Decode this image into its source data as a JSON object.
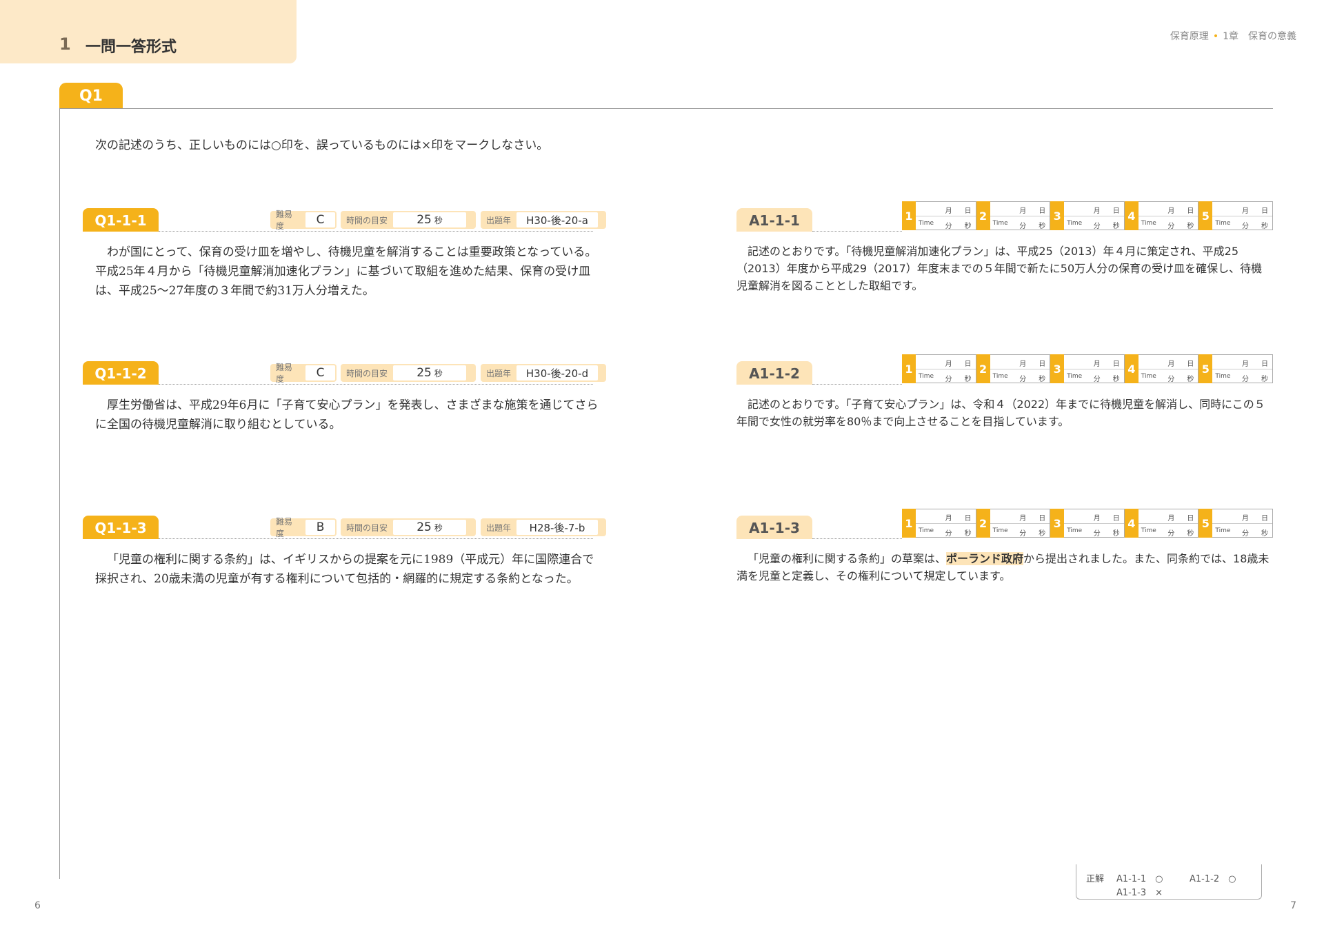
{
  "chapter": {
    "number": "1",
    "title": "一問一答形式"
  },
  "running_head": {
    "subject": "保育原理",
    "chapter": "1章　保育の意義"
  },
  "section": {
    "tag": "Q1",
    "instruction": "次の記述のうち、正しいものには○印を、誤っているものには×印をマークしなさい。"
  },
  "labels": {
    "difficulty": "難易度",
    "time": "時間の目安",
    "year": "出題年",
    "seconds_unit": "秒"
  },
  "tracker_labels": {
    "month": "月",
    "day": "日",
    "time": "Time",
    "min": "分",
    "sec": "秒"
  },
  "questions": [
    {
      "id": "Q1-1-1",
      "difficulty": "C",
      "time": "25",
      "year": "H30-後-20-a",
      "text": "わが国にとって、保育の受け皿を増やし、待機児童を解消することは重要政策となっている。平成25年４月から「待機児童解消加速化プラン」に基づいて取組を進めた結果、保育の受け皿は、平成25～27年度の３年間で約31万人分増えた。",
      "answer_id": "A1-1-1",
      "answer": "記述のとおりです。「待機児童解消加速化プラン」は、平成25（2013）年４月に策定され、平成25（2013）年度から平成29（2017）年度末までの５年間で新たに50万人分の保育の受け皿を確保し、待機児童解消を図ることとした取組です。"
    },
    {
      "id": "Q1-1-2",
      "difficulty": "C",
      "time": "25",
      "year": "H30-後-20-d",
      "text": "厚生労働省は、平成29年6月に「子育て安心プラン」を発表し、さまざまな施策を通じてさらに全国の待機児童解消に取り組むとしている。",
      "answer_id": "A1-1-2",
      "answer": "記述のとおりです。「子育て安心プラン」は、令和４（2022）年までに待機児童を解消し、同時にこの５年間で女性の就労率を80％まで向上させることを目指しています。"
    },
    {
      "id": "Q1-1-3",
      "difficulty": "B",
      "time": "25",
      "year": "H28-後-7-b",
      "text": "「児童の権利に関する条約」は、イギリスからの提案を元に1989（平成元）年に国際連合で採択され、20歳未満の児童が有する権利について包括的・網羅的に規定する条約となった。",
      "answer_id": "A1-1-3",
      "answer_pre": "「児童の権利に関する条約」の草案は、",
      "answer_hl": "ポーランド政府",
      "answer_post": "から提出されました。また、同条約では、18歳未満を児童と定義し、その権利について規定しています。"
    }
  ],
  "answer_key": {
    "label": "正解",
    "r1": "A1-1-1　○",
    "r2": "A1-1-2　○",
    "r3": "A1-1-3　×"
  },
  "page_left": "6",
  "page_right": "7"
}
